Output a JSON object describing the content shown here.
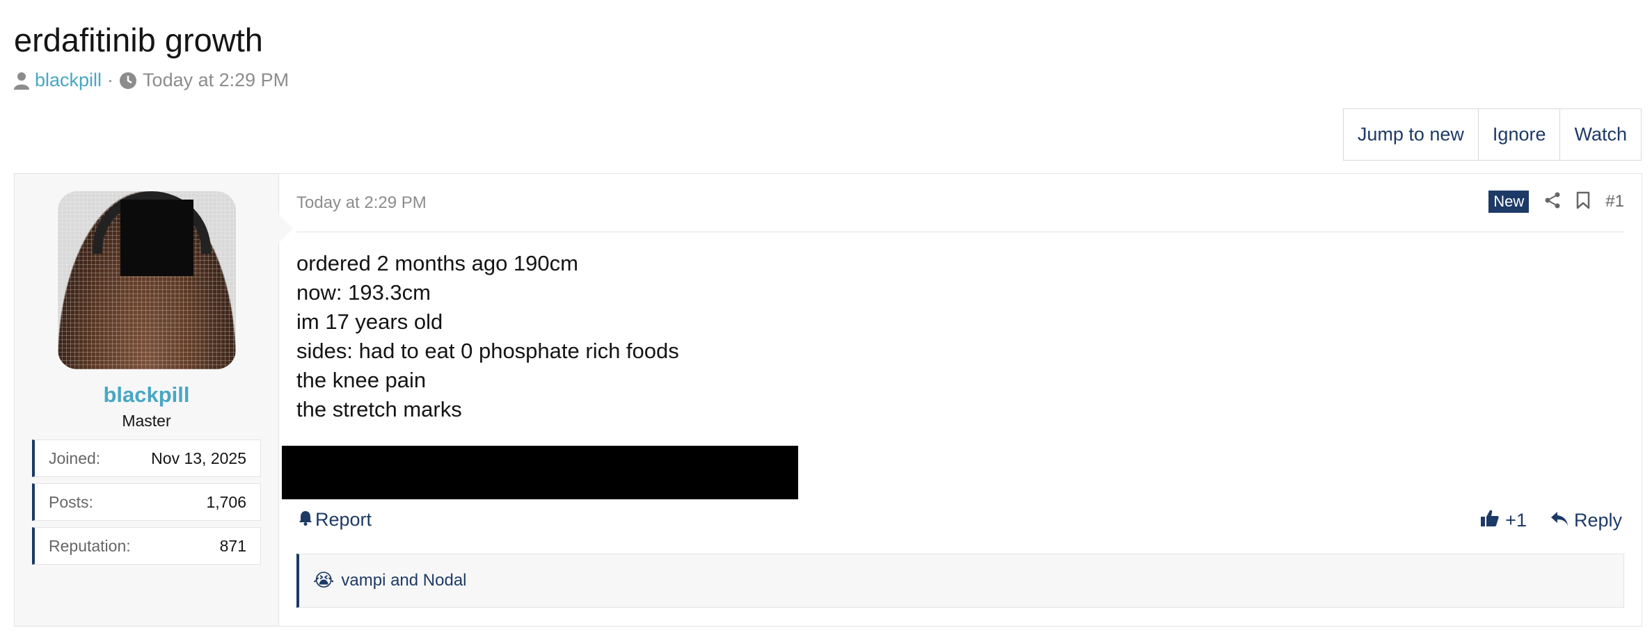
{
  "thread": {
    "title": "erdafitinib growth",
    "author": "blackpill",
    "separator": "·",
    "date": "Today at 2:29 PM"
  },
  "thread_actions": {
    "jump_to_new": "Jump to new",
    "ignore": "Ignore",
    "watch": "Watch"
  },
  "post": {
    "date": "Today at 2:29 PM",
    "badge": "New",
    "number": "#1",
    "user": {
      "name": "blackpill",
      "title": "Master",
      "stats": [
        {
          "label": "Joined:",
          "value": "Nov 13, 2025"
        },
        {
          "label": "Posts:",
          "value": "1,706"
        },
        {
          "label": "Reputation:",
          "value": "871"
        }
      ]
    },
    "body_lines": [
      "ordered 2 months ago 190cm",
      "now: 193.3cm",
      "im 17 years old",
      "sides: had to eat 0 phosphate rich foods",
      "the knee pain",
      "the stretch marks"
    ],
    "report_label": "Report",
    "like_label": "+1",
    "reply_label": "Reply",
    "reactions_text": "vampi and Nodal",
    "reaction_emoji": "😭"
  },
  "colors": {
    "accent": "#1d3a66",
    "username": "#47a7c4",
    "muted": "#8c8c8c",
    "panel_bg": "#f7f7f7"
  },
  "icons": [
    "user-icon",
    "clock-icon",
    "share-icon",
    "bookmark-icon",
    "bell-icon",
    "thumbs-up-icon",
    "reply-icon"
  ]
}
